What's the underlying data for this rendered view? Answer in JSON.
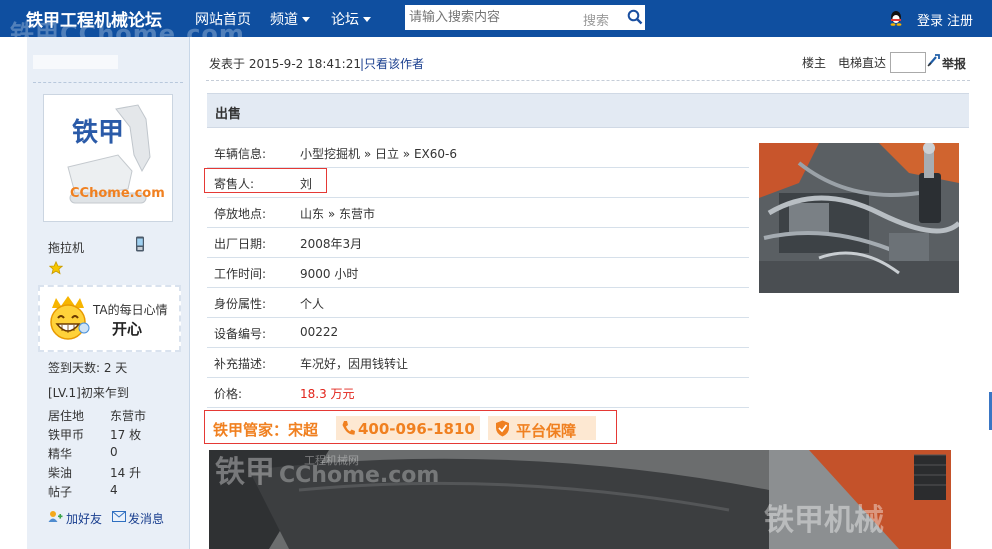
{
  "header": {
    "site_title": "铁甲工程机械论坛",
    "watermark": "铁甲CChome.com",
    "nav": {
      "home": "网站首页",
      "channel": "频道",
      "forum": "论坛"
    },
    "search": {
      "placeholder": "请输入搜索内容",
      "button": "搜索"
    },
    "login": "登录",
    "register": "注册"
  },
  "user": {
    "name": "拖拉机",
    "avatar_logo": "铁甲",
    "avatar_domain": "CChome.com",
    "mood": {
      "title": "TA的每日心情",
      "value": "开心"
    },
    "stats": [
      {
        "text": "签到天数: 2 天"
      },
      {
        "text": "[LV.1]初来乍到"
      }
    ],
    "profile": [
      {
        "label": "居住地",
        "value": "东营市"
      },
      {
        "label": "铁甲币",
        "value": "17 枚"
      },
      {
        "label": "精华",
        "value": "0"
      },
      {
        "label": "柴油",
        "value": "14 升"
      },
      {
        "label": "帖子",
        "value": "4"
      }
    ],
    "add_friend": "加好友",
    "send_message": "发消息"
  },
  "post": {
    "time": "发表于 2015-9-2 18:41:21",
    "only_author": "只看该作者",
    "floor": "楼主",
    "elevator": "电梯直达",
    "report": "举报"
  },
  "sale": {
    "title": "出售",
    "rows": [
      {
        "label": "车辆信息:",
        "value": "小型挖掘机 » 日立 » EX60-6"
      },
      {
        "label": "寄售人:",
        "value": "刘"
      },
      {
        "label": "停放地点:",
        "value": "山东 » 东营市"
      },
      {
        "label": "出厂日期:",
        "value": "2008年3月"
      },
      {
        "label": "工作时间:",
        "value": "9000 小时"
      },
      {
        "label": "身份属性:",
        "value": "个人"
      },
      {
        "label": "设备编号:",
        "value": "00222"
      },
      {
        "label": "补充描述:",
        "value": "车况好，因用钱转让"
      },
      {
        "label": "价格:",
        "value": "18.3 万元"
      }
    ]
  },
  "promo": {
    "manager": "铁甲管家：宋超",
    "phone": "400-096-1810",
    "guarantee": "平台保障"
  },
  "photo_watermarks": {
    "logo": "铁甲",
    "domain": "CChome.com",
    "site": "工程机械网",
    "corner": "铁甲机械"
  }
}
